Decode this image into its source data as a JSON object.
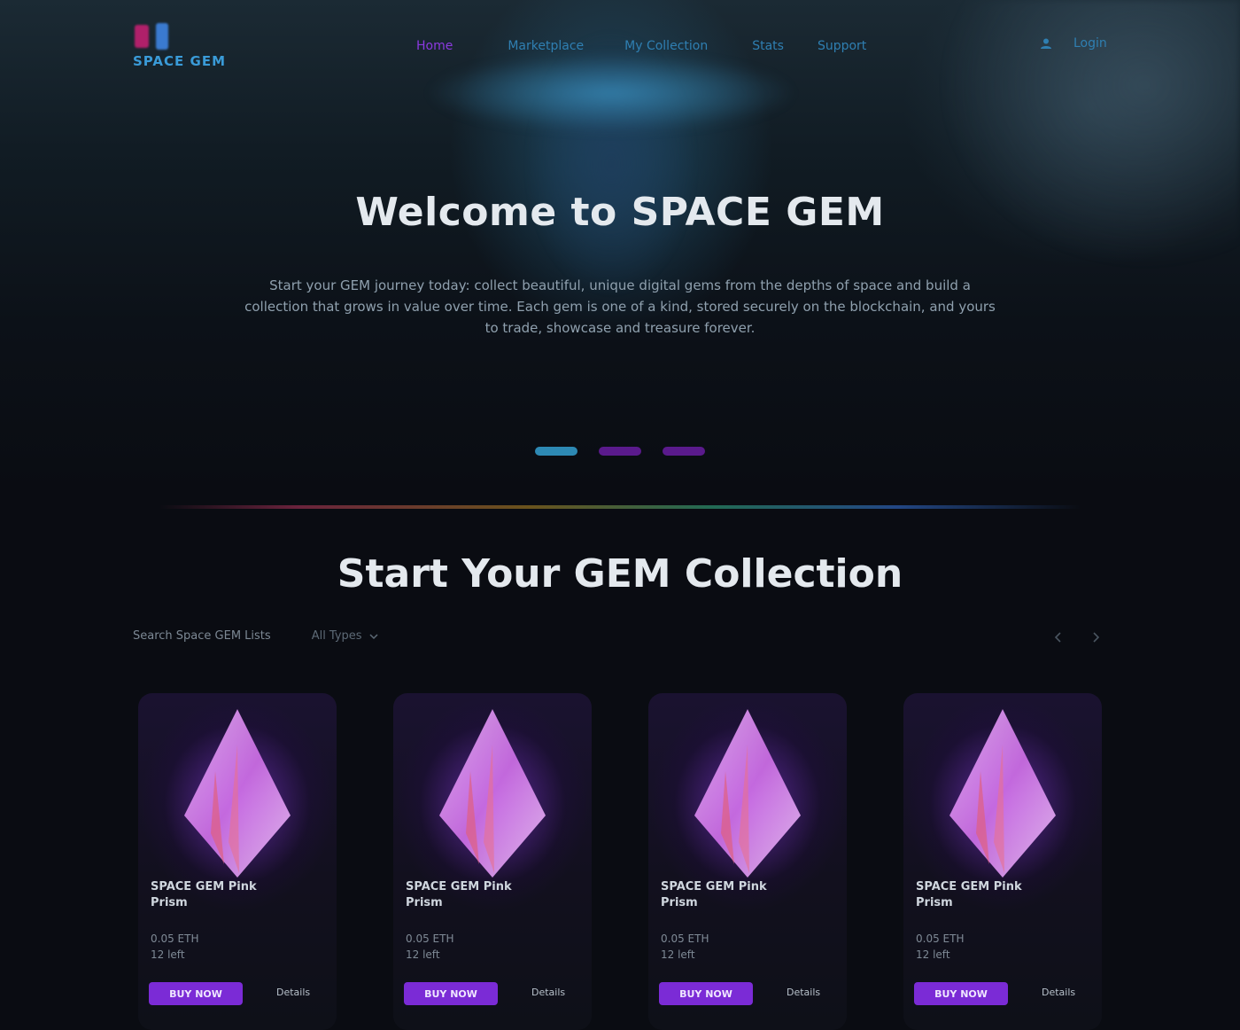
{
  "brand": {
    "logo_text": "SPACE GEM"
  },
  "nav": {
    "items": [
      {
        "label": "Home",
        "active": true
      },
      {
        "label": "Marketplace",
        "active": false
      },
      {
        "label": "My Collection",
        "active": false
      },
      {
        "label": "Stats",
        "active": false
      },
      {
        "label": "Support",
        "active": false
      }
    ],
    "login_label": "Login"
  },
  "hero": {
    "title": "Welcome to SPACE GEM",
    "description": "Start your GEM journey today: collect beautiful, unique digital gems from the depths of space and build a collection that grows in value over time. Each gem is one of a kind, stored securely on the blockchain, and yours to trade, showcase and treasure forever."
  },
  "carousel": {
    "slides": 3,
    "active_index": 0
  },
  "collection": {
    "title": "Start Your GEM Collection",
    "filter_label": "Search Space GEM Lists",
    "filter_value": "All Types"
  },
  "cards": [
    {
      "name": "SPACE GEM Pink Prism",
      "price": "0.05 ETH",
      "supply": "12 left",
      "buy_label": "BUY NOW",
      "detail_label": "Details"
    },
    {
      "name": "SPACE GEM Pink Prism",
      "price": "0.05 ETH",
      "supply": "12 left",
      "buy_label": "BUY NOW",
      "detail_label": "Details"
    },
    {
      "name": "SPACE GEM Pink Prism",
      "price": "0.05 ETH",
      "supply": "12 left",
      "buy_label": "BUY NOW",
      "detail_label": "Details"
    },
    {
      "name": "SPACE GEM Pink Prism",
      "price": "0.05 ETH",
      "supply": "12 left",
      "buy_label": "BUY NOW",
      "detail_label": "Details"
    }
  ],
  "colors": {
    "accent_purple": "#7b2bd6",
    "nav_blue": "#2f7fb2",
    "active_dot": "#2d89b4"
  },
  "icons": [
    "user-icon",
    "chevron-down-icon",
    "arrow-left-icon",
    "arrow-right-icon",
    "gem-icon"
  ]
}
